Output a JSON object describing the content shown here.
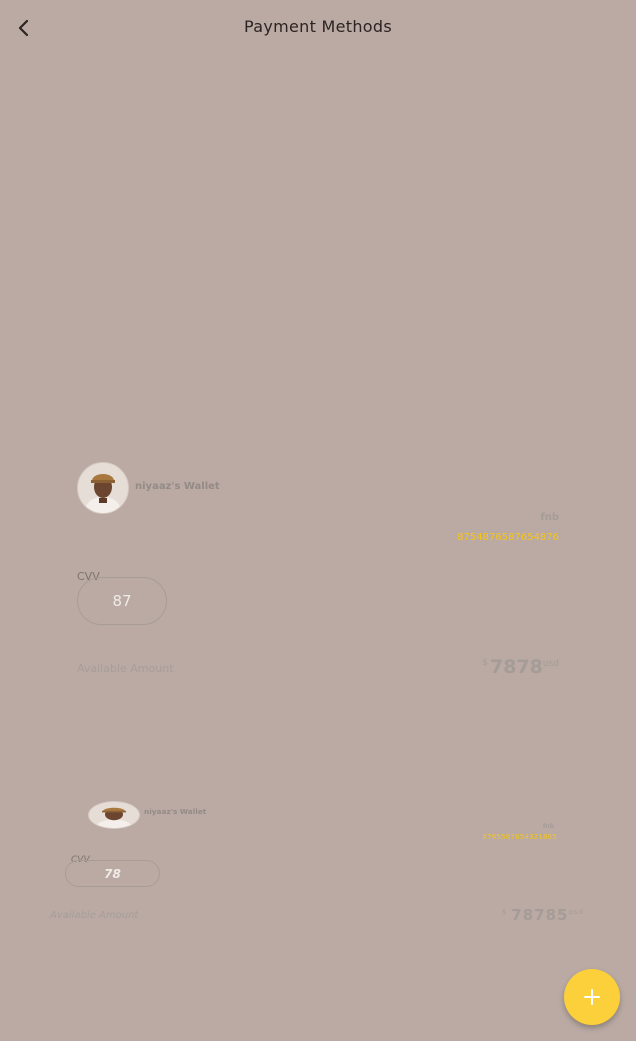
{
  "header": {
    "title": "Payment Methods"
  },
  "cards": [
    {
      "wallet_name": "niyaaz's Wallet",
      "bank": "fnb",
      "card_number": "8754876587654876",
      "cvv_label": "CVV",
      "cvv_value": "87",
      "available_label": "Available Amount",
      "currency_symbol": "$",
      "amount": "7878",
      "currency_unit": "usd"
    },
    {
      "wallet_name": "niyaaz's Wallet",
      "bank": "fnb",
      "card_number": "8765587654321865",
      "cvv_label": "CVV",
      "cvv_value": "78",
      "available_label": "Available Amount",
      "currency_symbol": "$",
      "amount": "78785",
      "currency_unit": "usd"
    }
  ],
  "colors": {
    "background": "#baaaa3",
    "accent": "#fcd03a",
    "card_number": "#f5c518"
  },
  "icons": {
    "back": "chevron-left-icon",
    "fab": "plus-icon",
    "avatar": "user-avatar"
  }
}
